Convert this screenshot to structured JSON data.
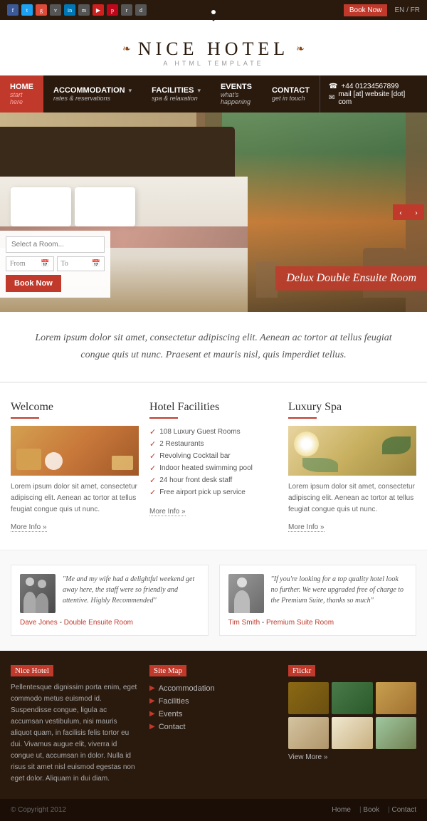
{
  "topbar": {
    "book_now": "Book Now",
    "lang": "EN / FR",
    "social_icons": [
      "f",
      "t",
      "g",
      "in",
      "vk",
      "yt",
      "pi",
      "rs",
      "d",
      "n"
    ]
  },
  "header": {
    "deco_left": "❧",
    "title": "NICE HOTEL",
    "deco_right": "❧",
    "subtitle": "A HTML TEMPLATE"
  },
  "nav": {
    "items": [
      {
        "label": "HOME",
        "sub": "start here",
        "active": true
      },
      {
        "label": "ACCOMMODATION",
        "sub": "rates & reservations",
        "has_arrow": true
      },
      {
        "label": "FACILITIES",
        "sub": "spa & relaxation",
        "has_arrow": true
      },
      {
        "label": "EVENTS",
        "sub": "what's happening"
      },
      {
        "label": "CONTACT",
        "sub": "get in touch"
      }
    ],
    "phone_icon": "☎",
    "phone": "+44 01234567899",
    "email_icon": "✉",
    "email": "mail [at] website [dot] com"
  },
  "hero": {
    "caption": "Delux Double Ensuite Room",
    "prev_label": "‹",
    "next_label": "›"
  },
  "booking": {
    "room_placeholder": "Select a Room...",
    "from_label": "From",
    "to_label": "To",
    "button_label": "Book Now"
  },
  "quote": {
    "text": "Lorem ipsum dolor sit amet, consectetur adipiscing elit. Aenean ac tortor at tellus feugiat congue quis ut nunc. Praesent et mauris nisl, quis imperdiet tellus."
  },
  "columns": [
    {
      "title": "Welcome",
      "text": "Lorem ipsum dolor sit amet, consectetur adipiscing elit. Aenean ac tortor at tellus feugiat congue quis ut nunc.",
      "more_info": "More Info"
    },
    {
      "title": "Hotel Facilities",
      "facilities": [
        "108 Luxury Guest Rooms",
        "2 Restaurants",
        "Revolving Cocktail bar",
        "Indoor heated swimming pool",
        "24 hour front desk staff",
        "Free airport pick up service"
      ],
      "more_info": "More Info"
    },
    {
      "title": "Luxury Spa",
      "text": "Lorem ipsum dolor sit amet, consectetur adipiscing elit. Aenean ac tortor at tellus feugiat congue quis ut nunc.",
      "more_info": "More Info"
    }
  ],
  "testimonials": [
    {
      "text": "\"Me and my wife had a delightful weekend get away here, the staff were so friendly and attentive. Highly Recommended\"",
      "author": "Dave Jones",
      "room": "Double Ensuite Room",
      "has_couple": true
    },
    {
      "text": "\"If you're looking for a top quality hotel look no further. We were upgraded free of charge to the Premium Suite, thanks so much\"",
      "author": "Tim Smith",
      "room": "Premium Suite Room",
      "has_couple": false
    }
  ],
  "footer": {
    "col1": {
      "title": "Nice Hotel",
      "text": "Pellentesque dignissim porta enim, eget commodo metus euismod id. Suspendisse congue, ligula ac accumsan vestibulum, nisi mauris aliquot quam, in facilisis felis tortor eu dui. Vivamus augue elit, viverra id congue ut, accumsan in dolor. Nulla id risus sit amet nisl euismod egestas non eget dolor. Aliquam in dui diam."
    },
    "col2": {
      "title": "Site Map",
      "links": [
        "Accommodation",
        "Facilities",
        "Events",
        "Contact"
      ]
    },
    "col3": {
      "title": "Flickr",
      "view_more": "View More"
    }
  },
  "bottom": {
    "copyright": "© Copyright 2012",
    "links": [
      "Home",
      "Book",
      "Contact"
    ]
  }
}
